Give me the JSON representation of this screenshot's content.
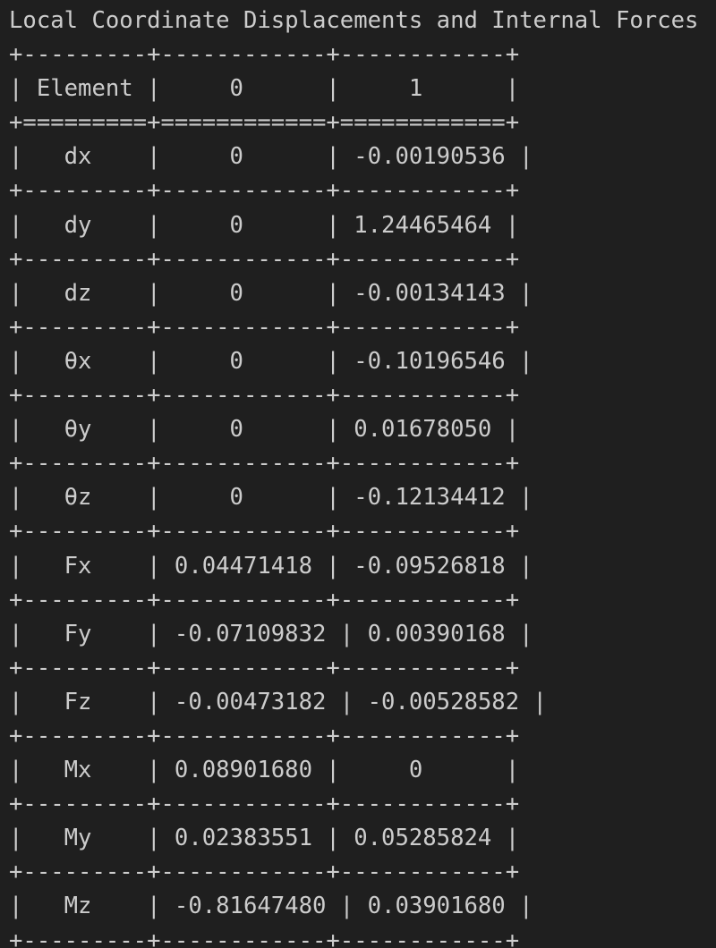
{
  "terminal": {
    "title_line": "Local Coordinate Displacements and Internal Forces",
    "colors": {
      "background": "#1f1f1f",
      "text": "#cccccc"
    },
    "lines": [
      "+---------+------------+------------+",
      "| Element |     0      |     1      |",
      "+=========+============+============+",
      "|   dx    |     0      | -0.00190536 |",
      "+---------+------------+------------+",
      "|   dy    |     0      | 1.24465464 |",
      "+---------+------------+------------+",
      "|   dz    |     0      | -0.00134143 |",
      "+---------+------------+------------+",
      "|   θx    |     0      | -0.10196546 |",
      "+---------+------------+------------+",
      "|   θy    |     0      | 0.01678050 |",
      "+---------+------------+------------+",
      "|   θz    |     0      | -0.12134412 |",
      "+---------+------------+------------+",
      "|   Fx    | 0.04471418 | -0.09526818 |",
      "+---------+------------+------------+",
      "|   Fy    | -0.07109832 | 0.00390168 |",
      "+---------+------------+------------+",
      "|   Fz    | -0.00473182 | -0.00528582 |",
      "+---------+------------+------------+",
      "|   Mx    | 0.08901680 |     0      |",
      "+---------+------------+------------+",
      "|   My    | 0.02383551 | 0.05285824 |",
      "+---------+------------+------------+",
      "|   Mz    | -0.81647480 | 0.03901680 |",
      "+---------+------------+------------+"
    ],
    "table": {
      "header": [
        "Element",
        "0",
        "1"
      ],
      "rows": [
        [
          "dx",
          "0",
          "-0.00190536"
        ],
        [
          "dy",
          "0",
          "1.24465464"
        ],
        [
          "dz",
          "0",
          "-0.00134143"
        ],
        [
          "θx",
          "0",
          "-0.10196546"
        ],
        [
          "θy",
          "0",
          "0.01678050"
        ],
        [
          "θz",
          "0",
          "-0.12134412"
        ],
        [
          "Fx",
          "0.04471418",
          "-0.09526818"
        ],
        [
          "Fy",
          "-0.07109832",
          "0.00390168"
        ],
        [
          "Fz",
          "-0.00473182",
          "-0.00528582"
        ],
        [
          "Mx",
          "0.08901680",
          "0"
        ],
        [
          "My",
          "0.02383551",
          "0.05285824"
        ],
        [
          "Mz",
          "-0.81647480",
          "0.03901680"
        ]
      ]
    }
  }
}
